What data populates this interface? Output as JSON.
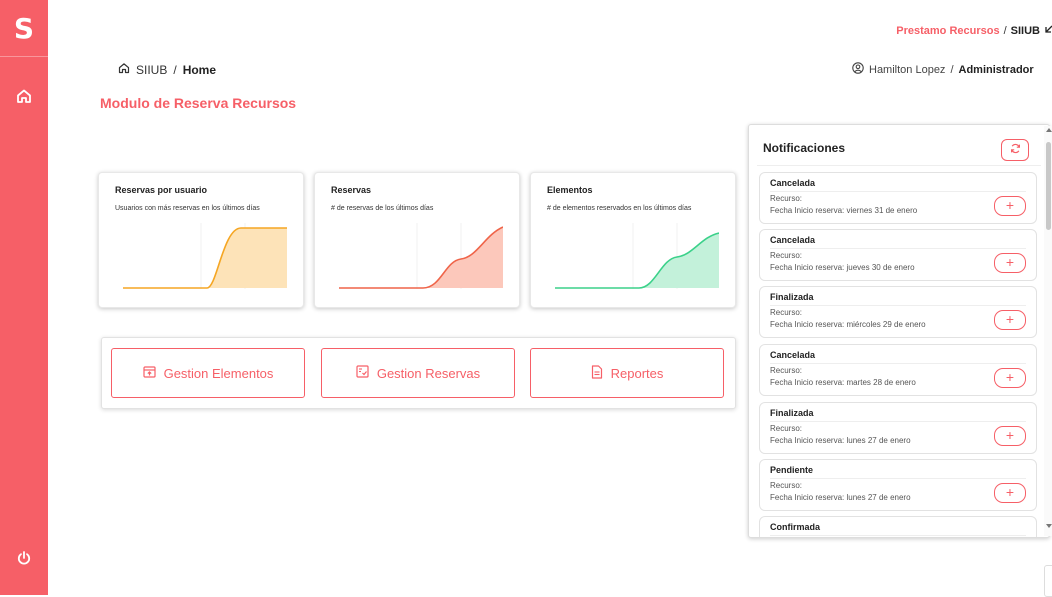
{
  "sidebar": {
    "logo_letter": "S",
    "icons": [
      "home-icon",
      "power-icon"
    ]
  },
  "topbar": {
    "module_link": "Prestamo Recursos",
    "separator": "/",
    "app_name": "SIIUB"
  },
  "breadcrumb": {
    "root": "SIIUB",
    "separator": "/",
    "current": "Home"
  },
  "user": {
    "name": "Hamilton Lopez",
    "separator": "/",
    "role": "Administrador"
  },
  "page_title": "Modulo de Reserva Recursos",
  "cards": [
    {
      "title": "Reservas por usuario",
      "subtitle": "Usuarios con más reservas en los últimos días",
      "color": "#f5a623",
      "fill": "#fde3b8"
    },
    {
      "title": "Reservas",
      "subtitle": "# de reservas de los últimos días",
      "color": "#ef6449",
      "fill": "#fcc8bb"
    },
    {
      "title": "Elementos",
      "subtitle": "# de elementos reservados en los últimos días",
      "color": "#3bd18a",
      "fill": "#c3f1da"
    }
  ],
  "actions": [
    {
      "label": "Gestion Elementos",
      "icon": "box-upload-icon"
    },
    {
      "label": "Gestion Reservas",
      "icon": "checklist-icon"
    },
    {
      "label": "Reportes",
      "icon": "document-icon"
    }
  ],
  "notifications": {
    "title": "Notificaciones",
    "items": [
      {
        "status": "Cancelada",
        "recurso": "Recurso:",
        "fecha": "Fecha Inicio reserva: viernes 31 de enero"
      },
      {
        "status": "Cancelada",
        "recurso": "Recurso:",
        "fecha": "Fecha Inicio reserva: jueves 30 de enero"
      },
      {
        "status": "Finalizada",
        "recurso": "Recurso:",
        "fecha": "Fecha Inicio reserva: miércoles 29 de enero"
      },
      {
        "status": "Cancelada",
        "recurso": "Recurso:",
        "fecha": "Fecha Inicio reserva: martes 28 de enero"
      },
      {
        "status": "Finalizada",
        "recurso": "Recurso:",
        "fecha": "Fecha Inicio reserva: lunes 27 de enero"
      },
      {
        "status": "Pendiente",
        "recurso": "Recurso:",
        "fecha": "Fecha Inicio reserva: lunes 27 de enero"
      },
      {
        "status": "Confirmada",
        "recurso": "",
        "fecha": ""
      }
    ],
    "add_label": "+"
  },
  "colors": {
    "accent": "#f65f67"
  }
}
